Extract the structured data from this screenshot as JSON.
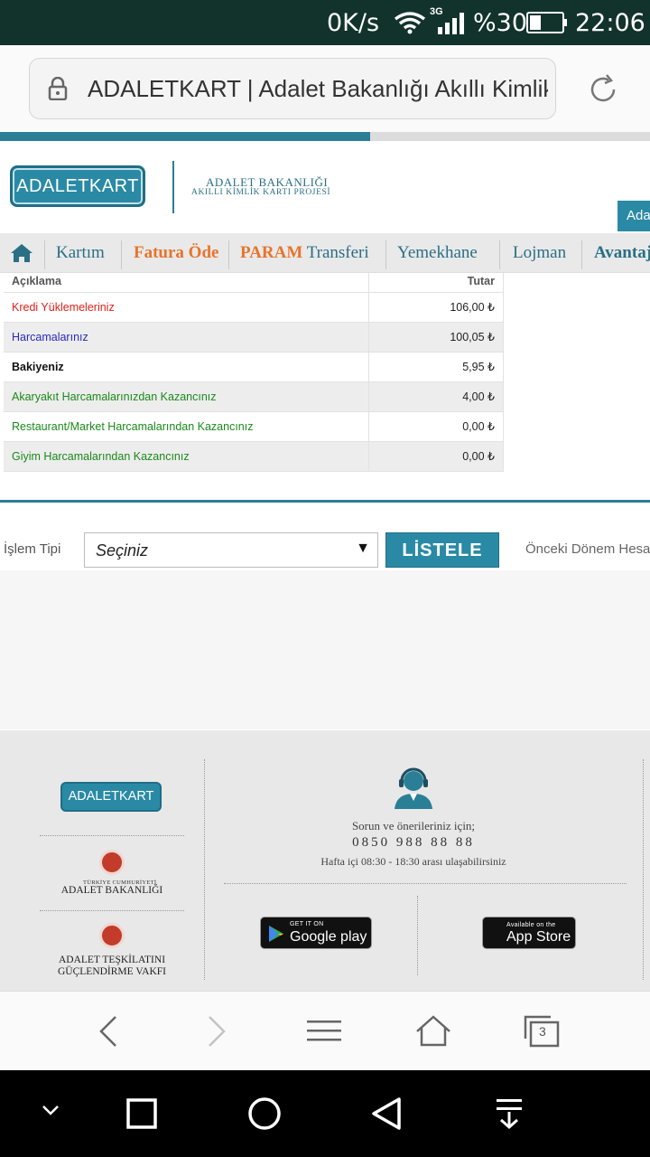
{
  "status_bar": {
    "speed": "0K/s",
    "network": "3G",
    "battery": "%30",
    "time": "22:06"
  },
  "browser": {
    "url_title": "ADALETKART | Adalet Bakanlığı Akıllı Kimlik",
    "tab_count": "3",
    "load_progress": 0.57
  },
  "header": {
    "logo_text": "ADALETKART",
    "ministry_line1": "ADALET BAKANLIĞI",
    "ministry_line2": "AKILLI KİMLİK KARTI PROJESİ",
    "side_tab": "Ada"
  },
  "nav": {
    "items": [
      {
        "label": "Kartım"
      },
      {
        "label": "Fatura Öde"
      },
      {
        "label_strong": "PARAM",
        "label": " Transferi"
      },
      {
        "label": "Yemekhane"
      },
      {
        "label": "Lojman"
      },
      {
        "label": "Avantaj"
      }
    ]
  },
  "table": {
    "headers": {
      "description": "Açıklama",
      "amount": "Tutar"
    },
    "rows": [
      {
        "label": "Kredi Yüklemeleriniz",
        "amount": "106,00 ₺",
        "color": "#e0201b"
      },
      {
        "label": "Harcamalarınız",
        "amount": "100,05 ₺",
        "color": "#2a2abf"
      },
      {
        "label": "Bakiyeniz",
        "amount": "5,95 ₺",
        "color": "#111111"
      },
      {
        "label": "Akaryakıt Harcamalarınızdan Kazancınız",
        "amount": "4,00 ₺",
        "color": "#1a8a1a"
      },
      {
        "label": "Restaurant/Market Harcamalarından Kazancınız",
        "amount": "0,00 ₺",
        "color": "#1a8a1a"
      },
      {
        "label": "Giyim Harcamalarından Kazancınız",
        "amount": "0,00 ₺",
        "color": "#1a8a1a"
      }
    ]
  },
  "filter": {
    "label": "İşlem Tipi",
    "select_value": "Seçiniz",
    "button": "LİSTELE",
    "prev_link": "Önceki Dönem Hesa"
  },
  "footer": {
    "logo_text": "ADALETKART",
    "org1_small": "TÜRKİYE CUMHURİYETİ",
    "org1": "ADALET BAKANLIĞI",
    "org2_line1": "ADALET TEŞKİLATINI",
    "org2_line2": "GÜÇLENDİRME VAKFI",
    "support_text": "Sorun ve önerileriniz için;",
    "phone": "0850 988 88 88",
    "hours": "Hafta içi 08:30 - 18:30 arası ulaşabilirsiniz",
    "google_small": "GET IT ON",
    "google_big": "Google play",
    "apple_small": "Available on the",
    "apple_big": "App Store"
  },
  "colors": {
    "brand": "#2a8aa5",
    "accent_orange": "#e8742a"
  }
}
